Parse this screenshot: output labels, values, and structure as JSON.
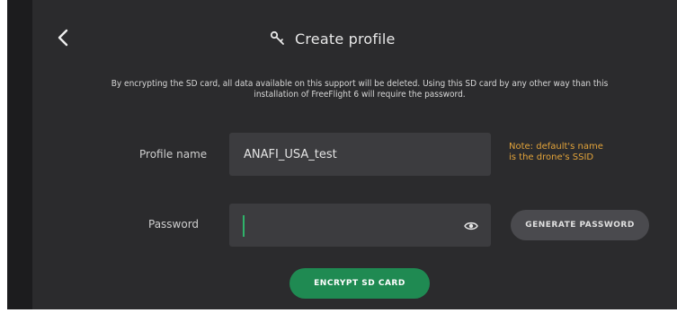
{
  "header": {
    "title": "Create profile",
    "icon": "key-icon"
  },
  "warning_text": "By encrypting the SD card, all data available on this support will be deleted. Using this SD card by any other way than this installation of FreeFlight 6 will require the password.",
  "form": {
    "profile_name_label": "Profile name",
    "profile_name_value": "ANAFI_USA_test",
    "password_label": "Password",
    "password_value": "",
    "note_line1": "Note: default's name",
    "note_line2": "is the drone's SSID"
  },
  "buttons": {
    "generate_password": "GENERATE PASSWORD",
    "encrypt_sd_card": "ENCRYPT SD CARD"
  },
  "colors": {
    "background": "#2b2b2d",
    "field": "#3c3c3f",
    "accent_green": "#1f8a52",
    "note_orange": "#e2a33a"
  }
}
